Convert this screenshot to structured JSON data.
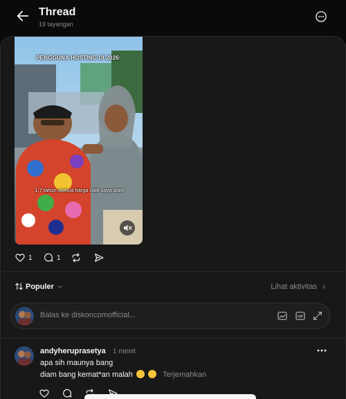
{
  "header": {
    "title": "Thread",
    "views": "19 tayangan"
  },
  "post": {
    "video": {
      "caption_top": "PENGGUNA HOSTING DI 2026:",
      "caption_bottom": "1,7 tahun semua harga naik saya diam",
      "muted": true
    },
    "actions": {
      "likes": "1",
      "replies": "1"
    }
  },
  "sort": {
    "label": "Populer",
    "activity_label": "Lihat aktivitas"
  },
  "reply_box": {
    "placeholder": "Balas ke diskoncomofficial..."
  },
  "comment": {
    "username": "andyheruprasetya",
    "time": "1 menit",
    "line1": "apa sih maunya bang",
    "line2": "diam bang kemat*an malah",
    "translate": "Terjemahkan"
  },
  "colors": {
    "background": "#0a0a0a",
    "card": "#181818",
    "text": "#f3f5f7",
    "muted_text": "#8a8a8a",
    "border": "#2b2b2b"
  }
}
